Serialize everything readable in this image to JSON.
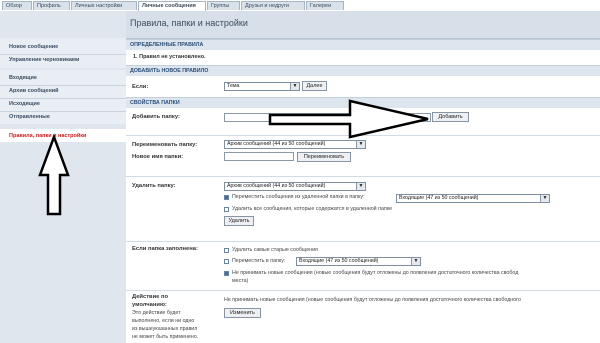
{
  "tabs": [
    "Обзор",
    "Профиль",
    "Личные настройки",
    "Личные сообщения",
    "Группы",
    "Друзья и недруги",
    "Галереи"
  ],
  "sidebar": {
    "group1": [
      "Новое сообщение",
      "Управление черновиками"
    ],
    "group2": [
      "Входящие",
      "Архив сообщений",
      "Исходящие",
      "Отправленные"
    ],
    "active": "Правила, папки и настройки"
  },
  "page_title": "Правила, папки и настройки",
  "rules": {
    "header": "ОПРЕДЕЛЕННЫЕ ПРАВИЛА",
    "item": "1. Правил не установлено.",
    "add_header": "ДОБАВИТЬ НОВОЕ ПРАВИЛО",
    "if_label": "Если:",
    "if_value": "Тема",
    "next_button": "Далее"
  },
  "folders": {
    "header": "СВОЙСТВА ПАПКИ",
    "add_label": "Добавить папку:",
    "add_button": "Добавить",
    "rename_label": "Переименовать папку:",
    "rename_value": "Архив сообщений (44 из 50 сообщений)",
    "new_name_label": "Новое имя папки:",
    "rename_button": "Переименовать",
    "delete_label": "Удалить папку:",
    "delete_value": "Архив сообщений (44 из 50 сообщений)",
    "move_option": "Переместить сообщения из удаленной папки в папку:",
    "move_target": "Входящие (47 из 50 сообщений)",
    "delete_all_option": "Удалить все сообщения, которые содержатся в удаленной папке",
    "delete_button": "Удалить"
  },
  "full": {
    "label": "Если папка заполнена:",
    "option1": "Удалить самые старые сообщения",
    "option2": "Переместить в папку:",
    "option2_target": "Входящие (47 из 50 сообщений)",
    "option3_line1": "Не принимать новые сообщения (новые сообщения будут отложены до появления достаточного количества свобод",
    "option3_line2": "места)",
    "default_label_1": "Действие по",
    "default_label_2": "умолчанию:",
    "default_note_1": "Это действие будет",
    "default_note_2": "выполнено, если ни одно",
    "default_note_3": "из вышеуказанных правил",
    "default_note_4": "не может быть применено.",
    "default_text": "Не принимать новые сообщения (новые сообщения будут отложены до появления достаточного количества свободного",
    "change_button": "Изменить"
  }
}
